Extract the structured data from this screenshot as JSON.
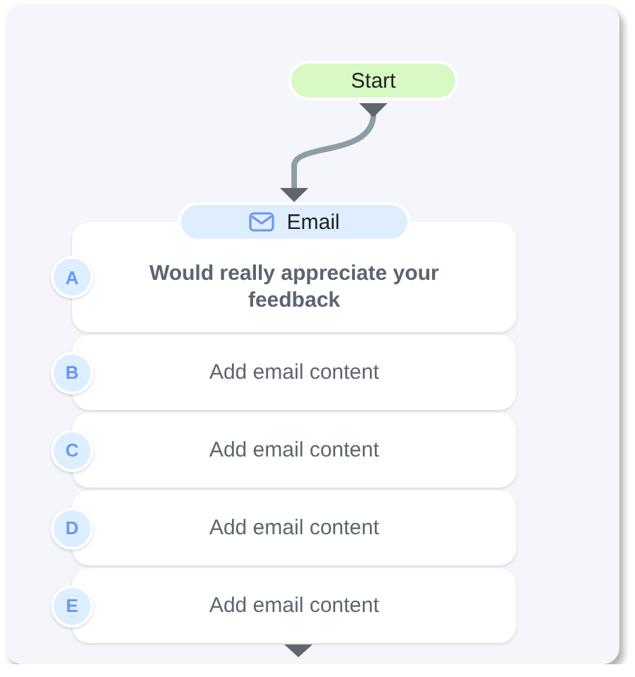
{
  "start": {
    "label": "Start"
  },
  "email": {
    "label": "Email"
  },
  "variants": [
    {
      "letter": "A",
      "kind": "filled",
      "text": "Would really appreciate your feedback"
    },
    {
      "letter": "B",
      "kind": "empty",
      "text": "Add email content"
    },
    {
      "letter": "C",
      "kind": "empty",
      "text": "Add email content"
    },
    {
      "letter": "D",
      "kind": "empty",
      "text": "Add email content"
    },
    {
      "letter": "E",
      "kind": "empty",
      "text": "Add email content"
    }
  ]
}
